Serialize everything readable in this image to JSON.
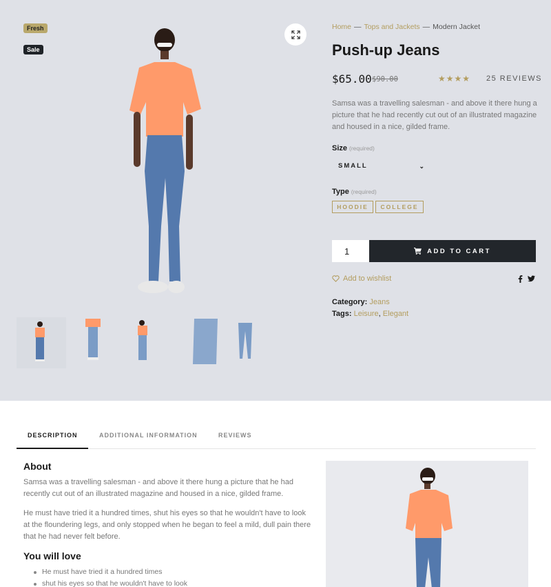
{
  "badges": {
    "fresh": "Fresh",
    "sale": "Sale"
  },
  "breadcrumb": {
    "home": "Home",
    "separator": "—",
    "category": "Tops and Jackets",
    "current": "Modern Jacket"
  },
  "product": {
    "title": "Push-up Jeans",
    "price": "$65.00",
    "old_price": "$90.00",
    "rating_stars": "★★★★",
    "rating_value": 4,
    "rating_max": 5,
    "reviews_link": "25 REVIEWS",
    "description": "Samsa was a travelling salesman - and above it there hung a picture that he had recently cut out of an illustrated magazine and housed in a nice, gilded frame."
  },
  "options": {
    "size_label": "Size",
    "required_text": "(required)",
    "size_value": "SMALL",
    "type_label": "Type",
    "type_options": [
      "HOODIE",
      "COLLEGE"
    ]
  },
  "cart": {
    "quantity": "1",
    "button_label": "ADD TO CART"
  },
  "wishlist_label": "Add to wishlist",
  "meta": {
    "category_label": "Category:",
    "category_value": "Jeans",
    "tags_label": "Tags:",
    "tags": [
      "Leisure",
      "Elegant"
    ],
    "tags_separator": ","
  },
  "tabs": [
    "DESCRIPTION",
    "ADDITIONAL INFORMATION",
    "REVIEWS"
  ],
  "description_section": {
    "about_title": "About",
    "about_text": "Samsa was a travelling salesman - and above it there hung a picture that he had recently cut out of an illustrated magazine and housed in a nice, gilded frame.",
    "para2": "He must have tried it a hundred times, shut his eyes so that he wouldn't have to look at the floundering legs, and only stopped when he began to feel a mild, dull pain there that he had never felt before.",
    "love_title": "You will love",
    "love_items": [
      "He must have tried it a hundred times",
      "shut his eyes so that he wouldn't have to look"
    ]
  },
  "colors": {
    "accent": "#b39d5e",
    "dark": "#22262b",
    "top_bg": "#dfe1e7",
    "shirt": "#ff9a6a",
    "jeans": "#5479ad"
  },
  "icons": {
    "zoom": "expand-icon",
    "cart": "cart-icon",
    "wishlist": "heart-icon",
    "facebook": "facebook-icon",
    "twitter": "twitter-icon",
    "dropdown": "chevron-down-icon"
  }
}
